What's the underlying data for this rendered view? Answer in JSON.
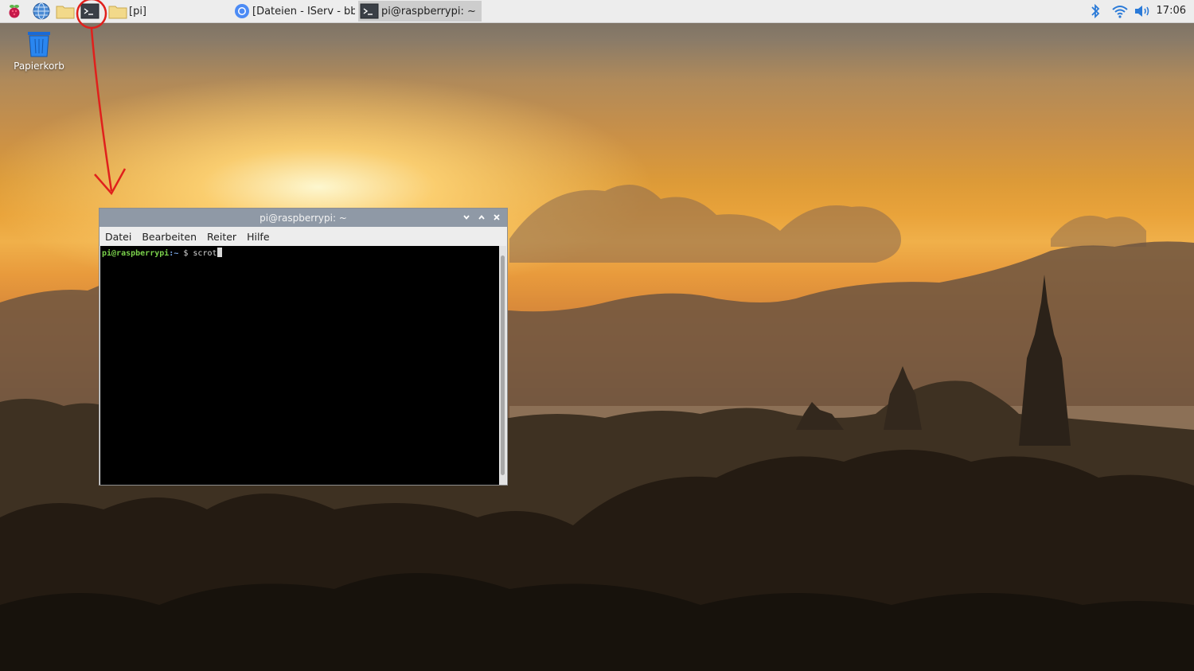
{
  "taskbar": {
    "icons": [
      "raspberry-menu-icon",
      "web-browser-icon",
      "file-manager-icon",
      "terminal-icon"
    ],
    "tasks": [
      {
        "label": "[pi]",
        "icon": "folder-icon"
      },
      {
        "label": "[Dateien - IServ - bbs...",
        "icon": "chromium-icon"
      },
      {
        "label": "pi@raspberrypi: ~",
        "icon": "terminal-icon"
      }
    ],
    "tray": [
      "bluetooth-icon",
      "wifi-icon",
      "volume-icon"
    ],
    "clock": "17:06"
  },
  "desktop": {
    "trash_label": "Papierkorb"
  },
  "terminal_window": {
    "title": "pi@raspberrypi: ~",
    "menu": [
      "Datei",
      "Bearbeiten",
      "Reiter",
      "Hilfe"
    ],
    "prompt_user": "pi@raspberrypi",
    "prompt_path": ":~",
    "prompt_symbol": " $ ",
    "command": "scrot"
  },
  "colors": {
    "panel": "#ededed",
    "titlebar": "#8f99a6",
    "annotation": "#e0201c"
  }
}
